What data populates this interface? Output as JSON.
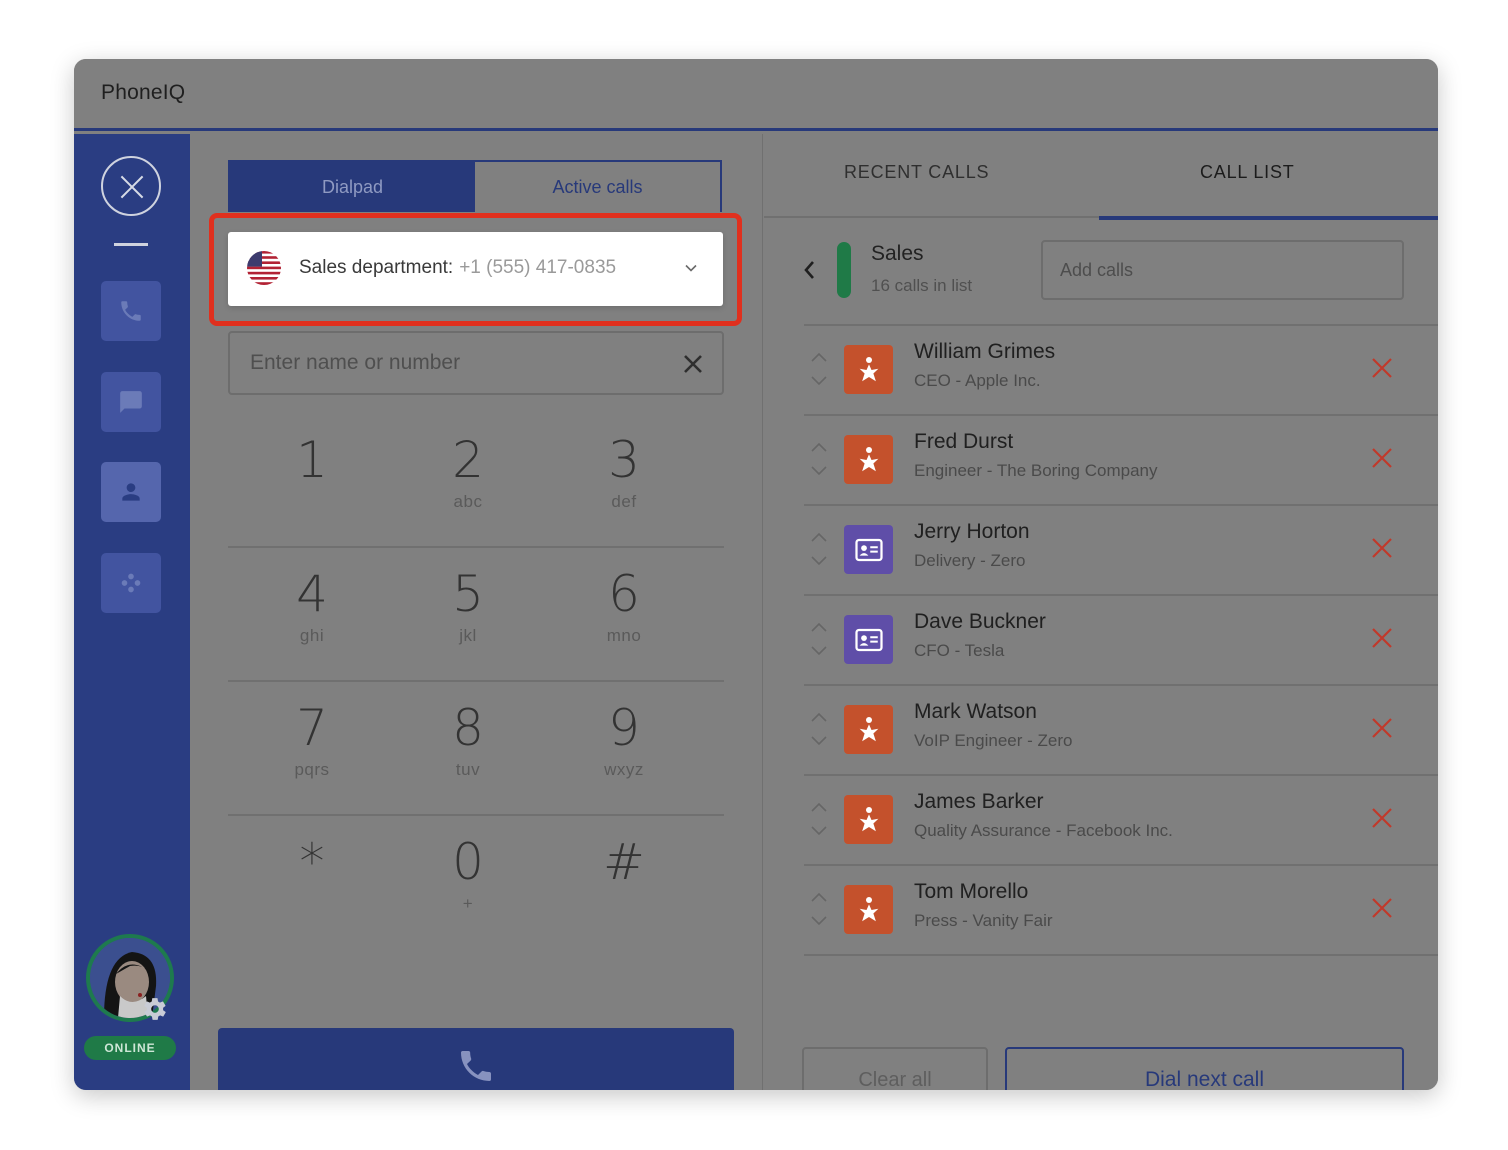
{
  "app": {
    "title": "PhoneIQ"
  },
  "sidebar": {
    "status": "ONLINE",
    "nav": [
      {
        "name": "phone-nav",
        "icon": "phone-icon"
      },
      {
        "name": "messages-nav",
        "icon": "chat-icon"
      },
      {
        "name": "contacts-nav",
        "icon": "person-icon"
      },
      {
        "name": "apps-nav",
        "icon": "dots-icon"
      }
    ]
  },
  "dialer": {
    "tabs": [
      {
        "label": "Dialpad",
        "active": true
      },
      {
        "label": "Active calls",
        "active": false
      }
    ],
    "number_select": {
      "label": "Sales department:",
      "number": "+1 (555) 417-0835"
    },
    "search": {
      "placeholder": "Enter name or number"
    },
    "keypad": [
      [
        {
          "digit": "1",
          "letters": ""
        },
        {
          "digit": "2",
          "letters": "abc"
        },
        {
          "digit": "3",
          "letters": "def"
        }
      ],
      [
        {
          "digit": "4",
          "letters": "ghi"
        },
        {
          "digit": "5",
          "letters": "jkl"
        },
        {
          "digit": "6",
          "letters": "mno"
        }
      ],
      [
        {
          "digit": "7",
          "letters": "pqrs"
        },
        {
          "digit": "8",
          "letters": "tuv"
        },
        {
          "digit": "9",
          "letters": "wxyz"
        }
      ],
      [
        {
          "digit": "*",
          "letters": ""
        },
        {
          "digit": "0",
          "letters": "+"
        },
        {
          "digit": "#",
          "letters": ""
        }
      ]
    ]
  },
  "right_panel": {
    "tabs": [
      {
        "label": "RECENT CALLS",
        "active": false
      },
      {
        "label": "CALL LIST",
        "active": true
      }
    ],
    "list": {
      "name": "Sales",
      "count": "16 calls in list",
      "add_placeholder": "Add calls"
    },
    "items": [
      {
        "name": "William Grimes",
        "subtitle": "CEO - Apple Inc.",
        "icon": "star"
      },
      {
        "name": "Fred Durst",
        "subtitle": "Engineer - The Boring Company",
        "icon": "star"
      },
      {
        "name": "Jerry Horton",
        "subtitle": "Delivery - Zero",
        "icon": "card"
      },
      {
        "name": "Dave Buckner",
        "subtitle": "CFO - Tesla",
        "icon": "card"
      },
      {
        "name": "Mark Watson",
        "subtitle": "VoIP Engineer - Zero",
        "icon": "star"
      },
      {
        "name": "James Barker",
        "subtitle": "Quality Assurance - Facebook Inc.",
        "icon": "star"
      },
      {
        "name": "Tom Morello",
        "subtitle": "Press - Vanity Fair",
        "icon": "star"
      }
    ],
    "clear_all": "Clear all",
    "dial_next": "Dial next call"
  },
  "colors": {
    "accent": "#27397a",
    "highlight": "#e0301e",
    "online": "#1f7a47",
    "star_icon": "#c4512c",
    "card_icon": "#5f4ea8",
    "remove": "#c0392b"
  }
}
